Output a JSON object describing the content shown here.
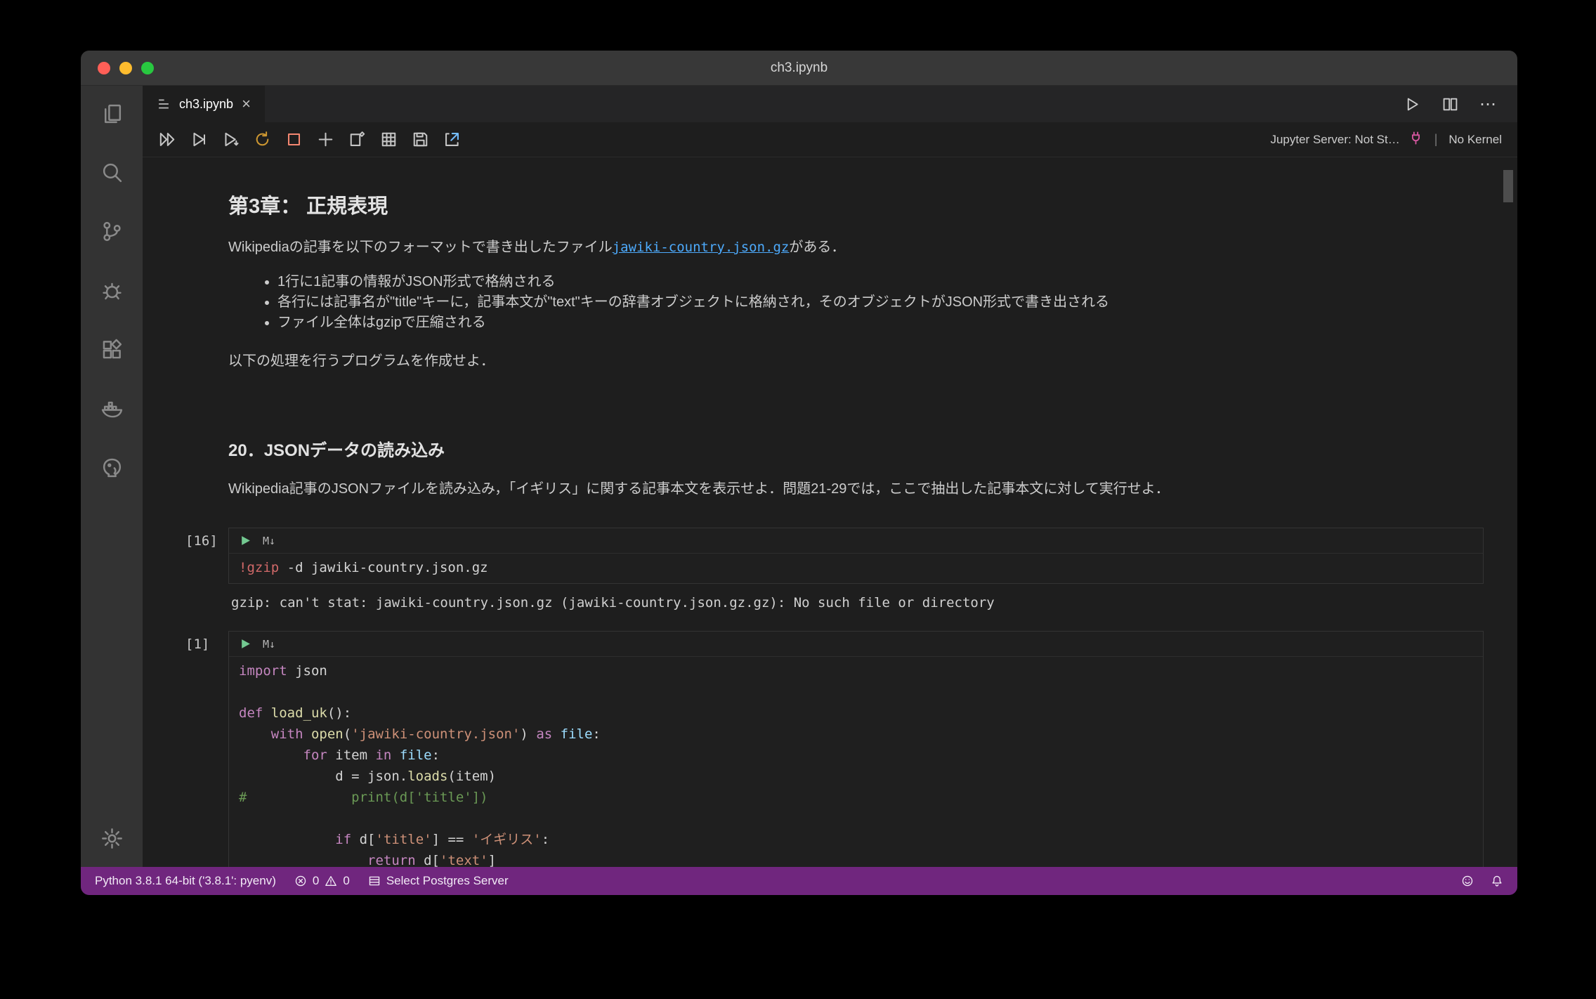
{
  "window": {
    "title": "ch3.ipynb"
  },
  "tab": {
    "label": "ch3.ipynb",
    "close_glyph": "×"
  },
  "editor_actions": {
    "ellipsis": "⋯"
  },
  "nb_toolbar": {
    "add_glyph": "+",
    "jupyter_server_label": "Jupyter Server: Not St…",
    "separator": "|",
    "kernel_label": "No Kernel"
  },
  "notebook": {
    "markdown1": {
      "heading": "第3章： 正規表現",
      "para1_pre": "Wikipediaの記事を以下のフォーマットで書き出したファイル",
      "para1_link": "jawiki-country.json.gz",
      "para1_post": "がある．",
      "bullets": [
        "1行に1記事の情報がJSON形式で格納される",
        "各行には記事名が\"title\"キーに，記事本文が\"text\"キーの辞書オブジェクトに格納され，そのオブジェクトがJSON形式で書き出される",
        "ファイル全体はgzipで圧縮される"
      ],
      "para2": "以下の処理を行うプログラムを作成せよ．"
    },
    "markdown2": {
      "heading": "20．JSONデータの読み込み",
      "para": "Wikipedia記事のJSONファイルを読み込み，「イギリス」に関する記事本文を表示せよ．問題21-29では，ここで抽出した記事本文に対して実行せよ．"
    },
    "cells": [
      {
        "exec_count": "[16]",
        "lang_badge": "M↓",
        "code": [
          [
            {
              "t": "!gzip",
              "c": "shell"
            },
            {
              "t": " -d jawiki-country.json.gz",
              "c": "plain"
            }
          ]
        ],
        "output": "gzip: can't stat: jawiki-country.json.gz (jawiki-country.json.gz.gz): No such file or directory"
      },
      {
        "exec_count": "[1]",
        "lang_badge": "M↓",
        "code": [
          [
            {
              "t": "import",
              "c": "kw"
            },
            {
              "t": " json",
              "c": "plain"
            }
          ],
          [],
          [
            {
              "t": "def",
              "c": "kw"
            },
            {
              "t": " ",
              "c": "plain"
            },
            {
              "t": "load_uk",
              "c": "fn"
            },
            {
              "t": "():",
              "c": "plain"
            }
          ],
          [
            {
              "t": "    ",
              "c": "plain"
            },
            {
              "t": "with",
              "c": "kw"
            },
            {
              "t": " ",
              "c": "plain"
            },
            {
              "t": "open",
              "c": "fn"
            },
            {
              "t": "(",
              "c": "plain"
            },
            {
              "t": "'jawiki-country.json'",
              "c": "str"
            },
            {
              "t": ") ",
              "c": "plain"
            },
            {
              "t": "as",
              "c": "kw"
            },
            {
              "t": " ",
              "c": "plain"
            },
            {
              "t": "file",
              "c": "var"
            },
            {
              "t": ":",
              "c": "plain"
            }
          ],
          [
            {
              "t": "        ",
              "c": "plain"
            },
            {
              "t": "for",
              "c": "kw"
            },
            {
              "t": " item ",
              "c": "plain"
            },
            {
              "t": "in",
              "c": "kw"
            },
            {
              "t": " ",
              "c": "plain"
            },
            {
              "t": "file",
              "c": "var"
            },
            {
              "t": ":",
              "c": "plain"
            }
          ],
          [
            {
              "t": "            d = json.",
              "c": "plain"
            },
            {
              "t": "loads",
              "c": "fn"
            },
            {
              "t": "(item)",
              "c": "plain"
            }
          ],
          [
            {
              "t": "#             print(d['title'])",
              "c": "com"
            }
          ],
          [],
          [
            {
              "t": "            ",
              "c": "plain"
            },
            {
              "t": "if",
              "c": "kw"
            },
            {
              "t": " d[",
              "c": "plain"
            },
            {
              "t": "'title'",
              "c": "str"
            },
            {
              "t": "] ",
              "c": "plain"
            },
            {
              "t": "==",
              "c": "op"
            },
            {
              "t": " ",
              "c": "plain"
            },
            {
              "t": "'イギリス'",
              "c": "str"
            },
            {
              "t": ":",
              "c": "plain"
            }
          ],
          [
            {
              "t": "                ",
              "c": "plain"
            },
            {
              "t": "return",
              "c": "kw"
            },
            {
              "t": " d[",
              "c": "plain"
            },
            {
              "t": "'text'",
              "c": "str"
            },
            {
              "t": "]",
              "c": "plain"
            }
          ]
        ],
        "output": ""
      }
    ]
  },
  "statusbar": {
    "python_label": "Python 3.8.1 64-bit ('3.8.1': pyenv)",
    "error_count": "0",
    "warning_count": "0",
    "postgres_label": "Select Postgres Server"
  },
  "colors": {
    "statusbar_bg": "#70267E",
    "link": "#4DAAFC",
    "traffic_red": "#FF5F57",
    "traffic_yellow": "#FEBC2E",
    "traffic_green": "#28C840",
    "tokens": {
      "kw": "#C586C0",
      "fn": "#DCDCAA",
      "str": "#CE9178",
      "com": "#6A9955",
      "var": "#9CDCFE",
      "plain": "#D4D4D4",
      "op": "#D4D4D4",
      "shell": "#D16969"
    }
  }
}
